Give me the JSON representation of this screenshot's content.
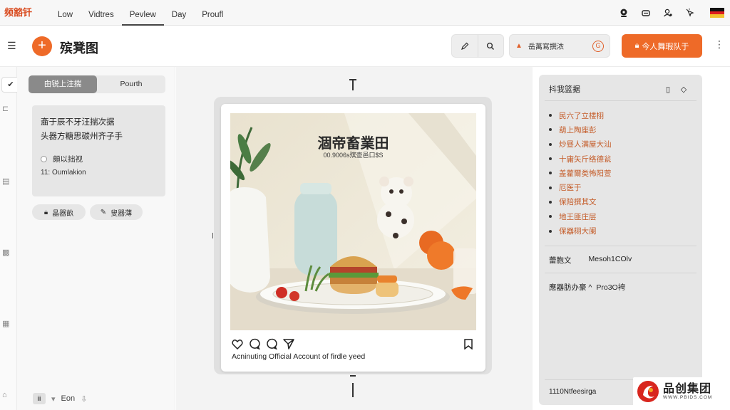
{
  "app": {
    "logo": "频豁钎",
    "tabs": [
      "Low",
      "Vidtres",
      "Pevlew",
      "Day",
      "Proufl"
    ],
    "active_tab": "Pevlew"
  },
  "topbar": {
    "icons": [
      "camera-icon",
      "router-icon",
      "user-gear-icon",
      "cursor-click-icon",
      "flag-icon"
    ],
    "flag_colors": [
      "#111111",
      "#dd1e1e",
      "#f2c230"
    ]
  },
  "header": {
    "title": "殡凳图",
    "tools": [
      "pen-icon",
      "search-icon"
    ],
    "dropdown": {
      "label": "岳萬寫撰浓",
      "icon": "circle-g-icon"
    },
    "primary": {
      "label": "今人舞瑕队于",
      "icon": "lock-icon"
    },
    "accent": "#ee6a28"
  },
  "left_panel": {
    "segments": [
      "甶锐上注揣",
      "Pourth"
    ],
    "active_segment": 0,
    "note": {
      "lines": [
        "齑于辰不牙汪揣次据",
        "头器方糖思碳州齐子手"
      ],
      "radio_label": "頗以拙视",
      "sub": "11: Oumlakion"
    },
    "chips": [
      {
        "icon": "lock-icon",
        "label": "晶器畝"
      },
      {
        "icon": "pen-icon",
        "label": "叟器薄"
      }
    ],
    "footer": {
      "badge": "ⅲ",
      "label": "Eon"
    }
  },
  "canvas": {
    "post": {
      "overlay_title": "涸帝畜業田",
      "overlay_sub": "00.9006s殡壶邑口$S",
      "caption": "Acninuting Official Account of firdle yeed"
    }
  },
  "right_panel": {
    "title": "抖我篮据",
    "layers": [
      "民六了立楼栩",
      "葫上陶座彭",
      "炒昼人满屋大汕",
      "十庸矢斤络德瓮",
      "盖藿爾类怖阳萱",
      "厄医于",
      "保陪撰其文",
      "地王匪庄层",
      "保器栩大阑"
    ],
    "props": [
      {
        "key": "蕾胞文",
        "value": "Mesoh1COlv"
      },
      {
        "key": "應器肪办豪 ^",
        "value": "Pro3O袴"
      }
    ],
    "footer": "1110Ntfeesirga"
  },
  "brand": {
    "name": "品创集团",
    "url": "WWW.PBIDS.COM"
  }
}
